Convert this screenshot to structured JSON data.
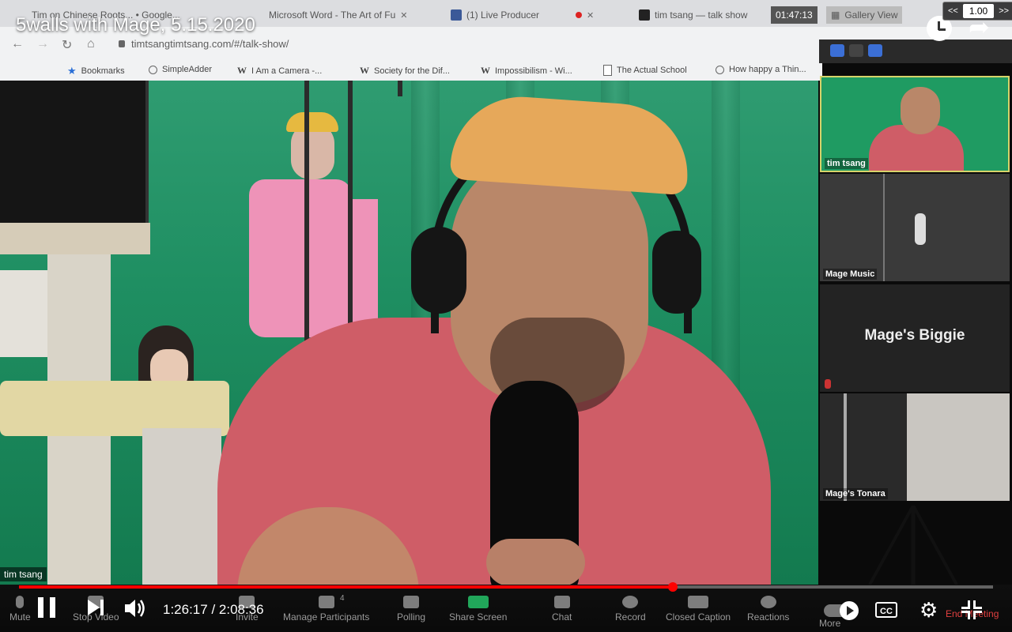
{
  "video": {
    "title": "5walls with Mage, 5.15.2020",
    "current_time": "1:26:17",
    "duration": "2:08:36",
    "time_separator": " / ",
    "progress": 0.6713,
    "speed_decrease": "<<",
    "speed_value": "1.00",
    "speed_increase": ">>",
    "cc_label": "CC"
  },
  "browser": {
    "tabs": [
      {
        "label": "Tim on Chinese Roots... • Google...",
        "icon": "youtube-icon"
      },
      {
        "label": "Microsoft Word - The Art of Fu",
        "icon": "word-icon"
      },
      {
        "label": "(1) Live Producer",
        "icon": "facebook-icon"
      },
      {
        "label": "tim tsang — talk show",
        "icon": "video-icon"
      },
      {
        "label": "01:47:13",
        "icon": "timer"
      },
      {
        "label": "Gallery View",
        "icon": "grid-icon"
      }
    ],
    "url": "timtsangtimtsang.com/#/talk-show/",
    "bookmarks": [
      {
        "label": "Bookmarks",
        "icon": "star-icon"
      },
      {
        "label": "SimpleAdder",
        "icon": "globe-icon"
      },
      {
        "label": "I Am a Camera -...",
        "icon": "wikipedia-icon"
      },
      {
        "label": "Society for the Dif...",
        "icon": "wikipedia-icon"
      },
      {
        "label": "Impossibilism - Wi...",
        "icon": "wikipedia-icon"
      },
      {
        "label": "The Actual School",
        "icon": "document-icon"
      },
      {
        "label": "How happy a Thin...",
        "icon": "globe-icon"
      }
    ]
  },
  "scene": {
    "speaker_name": "tim tsang"
  },
  "gallery": {
    "tiles": [
      {
        "name": "tim tsang",
        "active": true
      },
      {
        "name": "Mage Music"
      },
      {
        "name": "",
        "center_label": "Mage's Biggie",
        "muted": true
      },
      {
        "name": "Mage's Tonara"
      }
    ]
  },
  "zoom_toolbar": {
    "buttons": [
      {
        "label": "Mute",
        "icon": "microphone-icon"
      },
      {
        "label": "Stop Video",
        "icon": "camera-icon"
      },
      {
        "label": "Invite",
        "icon": "invite-icon"
      },
      {
        "label": "Manage Participants",
        "icon": "participants-icon",
        "count": "4"
      },
      {
        "label": "Polling",
        "icon": "polling-icon"
      },
      {
        "label": "Share Screen",
        "icon": "share-screen-icon"
      },
      {
        "label": "Chat",
        "icon": "chat-icon"
      },
      {
        "label": "Record",
        "icon": "record-icon"
      },
      {
        "label": "Closed Caption",
        "icon": "cc-icon"
      },
      {
        "label": "Reactions",
        "icon": "reactions-icon"
      },
      {
        "label": "More",
        "icon": "more-icon"
      }
    ],
    "end_meeting": "End Meeting"
  },
  "colors": {
    "progress": "#ff0000",
    "share_screen": "#21a65a",
    "end_meeting": "#e04040"
  }
}
